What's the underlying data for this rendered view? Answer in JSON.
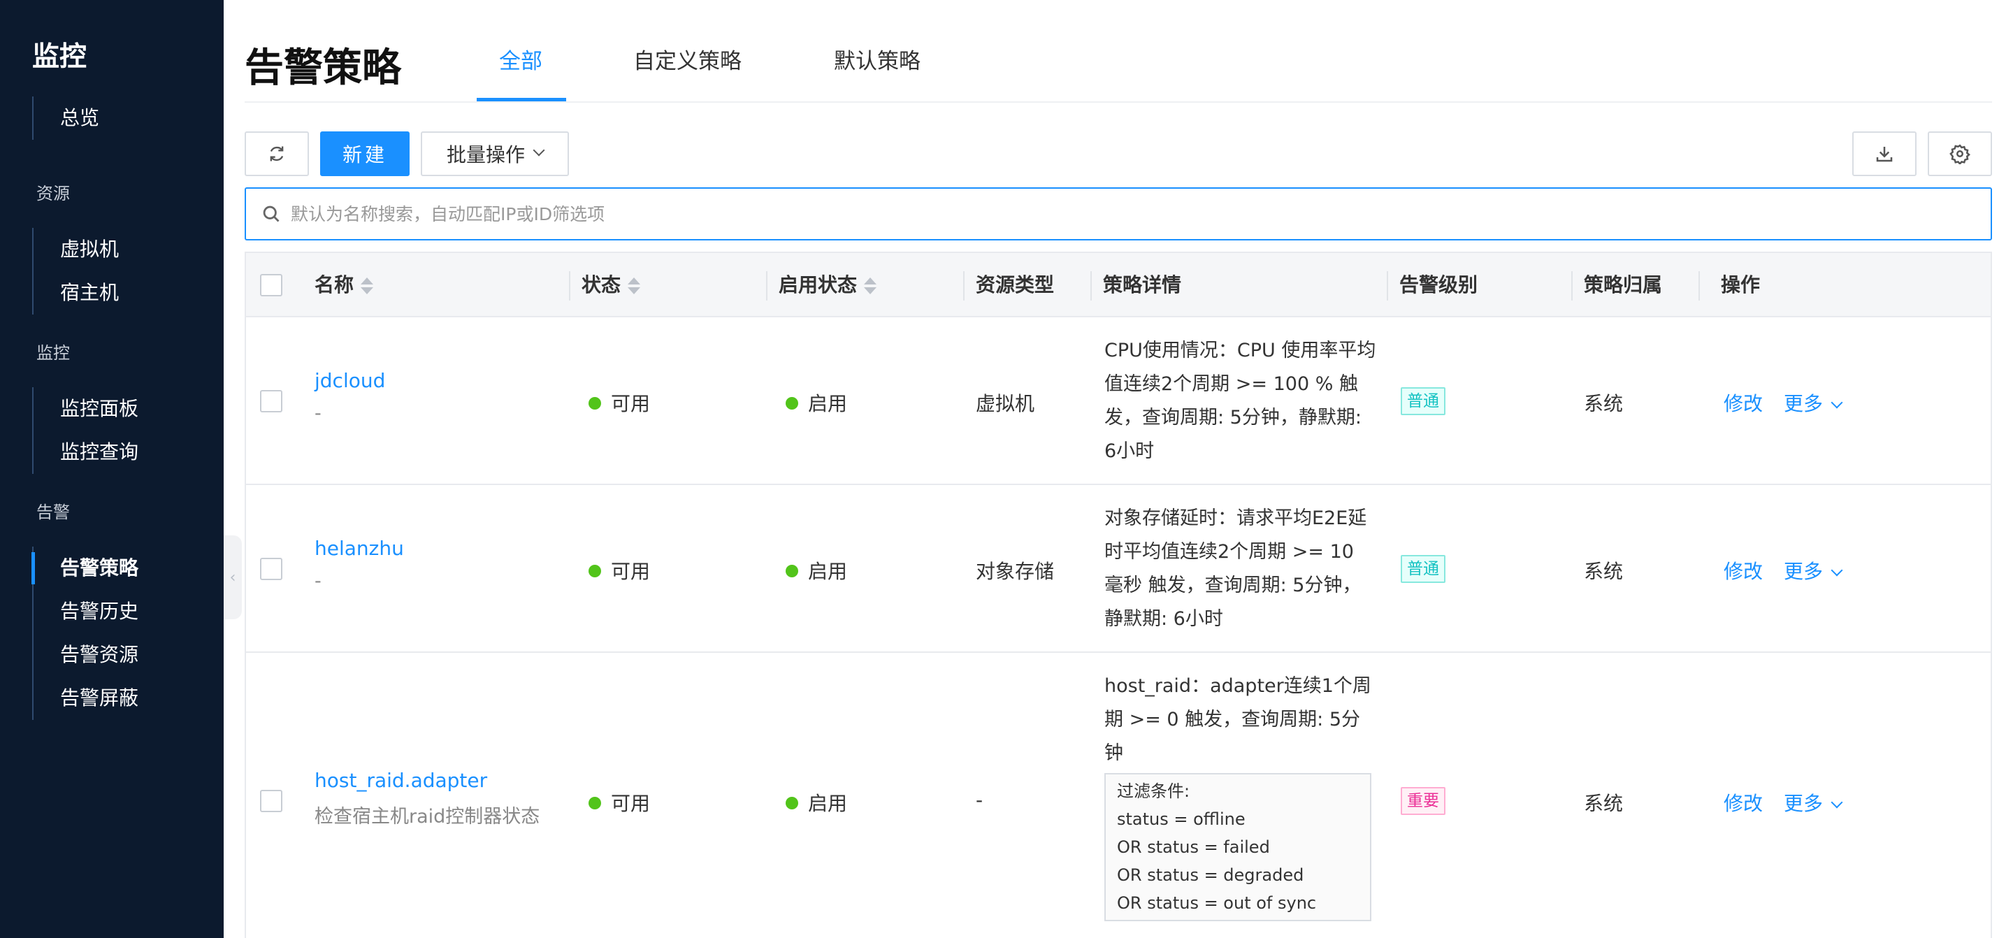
{
  "sidebar": {
    "title": "监控",
    "overview": "总览",
    "groups": {
      "resource": "资源",
      "monitor": "监控",
      "alarm": "告警"
    },
    "resource_items": [
      "虚拟机",
      "宿主机"
    ],
    "monitor_items": [
      "监控面板",
      "监控查询"
    ],
    "alarm_items": [
      "告警策略",
      "告警历史",
      "告警资源",
      "告警屏蔽"
    ],
    "active_item": "告警策略"
  },
  "header": {
    "title": "告警策略",
    "tabs": [
      "全部",
      "自定义策略",
      "默认策略"
    ],
    "active_tab": "全部"
  },
  "toolbar": {
    "refresh_icon": "refresh-icon",
    "new_label": "新建",
    "batch_label": "批量操作",
    "download_icon": "download-icon",
    "settings_icon": "gear-icon"
  },
  "search": {
    "placeholder": "默认为名称搜索，自动匹配IP或ID筛选项",
    "value": ""
  },
  "table": {
    "columns": [
      "名称",
      "状态",
      "启用状态",
      "资源类型",
      "策略详情",
      "告警级别",
      "策略归属",
      "操作"
    ],
    "rows": [
      {
        "name": "jdcloud",
        "desc": "-",
        "status": "可用",
        "enabled": "启用",
        "resource_type": "虚拟机",
        "detail": "CPU使用情况：CPU 使用率平均值连续2个周期 >= 100 % 触发，查询周期: 5分钟，静默期: 6小时",
        "level": "普通",
        "owner": "系统",
        "action_edit": "修改",
        "action_more": "更多"
      },
      {
        "name": "helanzhu",
        "desc": "-",
        "status": "可用",
        "enabled": "启用",
        "resource_type": "对象存储",
        "detail": "对象存储延时：请求平均E2E延时平均值连续2个周期 >= 10 毫秒 触发，查询周期: 5分钟，静默期: 6小时",
        "level": "普通",
        "owner": "系统",
        "action_edit": "修改",
        "action_more": "更多"
      },
      {
        "name": "host_raid.adapter",
        "desc": "检查宿主机raid控制器状态",
        "status": "可用",
        "enabled": "启用",
        "resource_type": "-",
        "detail": "host_raid：adapter连续1个周期 >= 0 触发，查询周期: 5分钟",
        "filter_title": "过滤条件:",
        "filter_lines": [
          "status = offline",
          "OR status = failed",
          "OR status = degraded",
          "OR status = out of sync"
        ],
        "level": "重要",
        "owner": "系统",
        "action_edit": "修改",
        "action_more": "更多"
      }
    ]
  },
  "colors": {
    "sidebar_bg": "#0c1a2e",
    "accent": "#1a90ff",
    "status_green": "#52c41a",
    "tag_normal": "#13c2c2",
    "tag_important": "#eb2f96"
  }
}
